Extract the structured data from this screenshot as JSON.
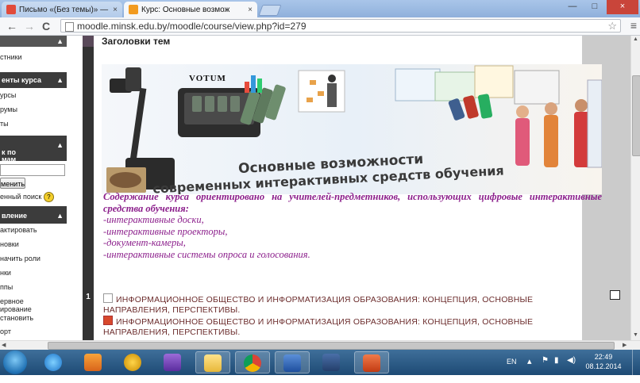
{
  "browser": {
    "tabs": [
      {
        "title": "Письмо «(Без темы)» —",
        "close": "×"
      },
      {
        "title": "Курс: Основные возмож",
        "close": "×"
      }
    ],
    "window_controls": {
      "minimize": "—",
      "maximize": "□",
      "close": "×"
    },
    "url": "moodle.minsk.edu.by/moodle/course/view.php?id=279",
    "nav": {
      "back": "←",
      "forward": "→",
      "reload": "C"
    }
  },
  "sidebar": {
    "items": [
      {
        "label": "стники"
      },
      {
        "label": "енты курса",
        "header": true
      },
      {
        "label": "урсы"
      },
      {
        "label": "румы"
      },
      {
        "label": "ты"
      },
      {
        "label": "к по\nмам",
        "header": true
      },
      {
        "label": "менить"
      },
      {
        "label": "енный поиск"
      },
      {
        "label": "вление",
        "header": true
      },
      {
        "label": "актировать"
      },
      {
        "label": "новки"
      },
      {
        "label": "начить роли"
      },
      {
        "label": "нки"
      },
      {
        "label": "ппы"
      },
      {
        "label": "ервное\nирование"
      },
      {
        "label": "становить"
      },
      {
        "label": "орт"
      }
    ],
    "header_icon": "▲",
    "help_icon": "?"
  },
  "main": {
    "section0_title": "Заголовки тем",
    "banner": {
      "votum": "VOTUM",
      "line1": "Основные возможности",
      "line2": "современных интерактивных средств обучения"
    },
    "description": {
      "lead": "Содержание курса ориентировано на учителей-предметников, использующих цифровые интерактивные средства обучения:",
      "items": [
        "-интерактивные доски,",
        "-интерактивные проекторы,",
        "-документ-камеры,",
        "-интерактивные системы опроса и голосования."
      ]
    },
    "section1": {
      "number": "1",
      "activities": [
        {
          "text": "ИНФОРМАЦИОННОЕ ОБЩЕСТВО И ИНФОРМАТИЗАЦИЯ ОБРАЗОВАНИЯ: КОНЦЕПЦИЯ, ОСНОВНЫЕ НАПРАВЛЕНИЯ, ПЕРСПЕКТИВЫ.",
          "icon": "page-icon"
        },
        {
          "text": "ИНФОРМАЦИОННОЕ ОБЩЕСТВО И ИНФОРМАТИЗАЦИЯ ОБРАЗОВАНИЯ: КОНЦЕПЦИЯ, ОСНОВНЫЕ НАПРАВЛЕНИЯ, ПЕРСПЕКТИВЫ.",
          "icon": "presentation-icon"
        }
      ]
    }
  },
  "taskbar": {
    "language": "EN",
    "time": "22:49",
    "date": "08.12.2014"
  },
  "colors": {
    "description_purple": "#8b1e8b",
    "activity_text": "#6b2c2c",
    "block_header": "#3c3c3c"
  }
}
